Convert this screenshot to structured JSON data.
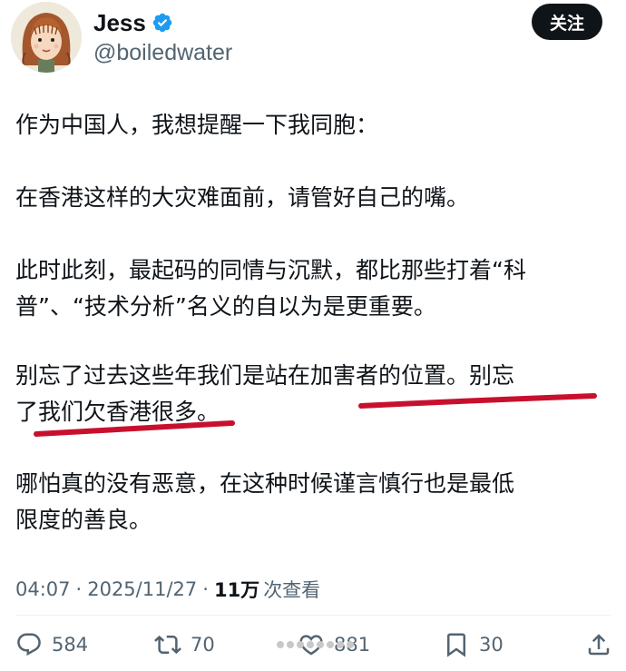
{
  "user": {
    "display_name": "Jess",
    "handle": "@boiledwater",
    "avatar_icon": "avatar-illustration",
    "verified_icon": "verified-badge-icon"
  },
  "follow_button": {
    "label": "关注"
  },
  "post": {
    "lines": [
      "作为中国人，我想提醒一下我同胞：",
      "在香港这样的大灾难面前，请管好自己的嘴。",
      "此时此刻，最起码的同情与沉默，都比那些打着“科",
      "普”、“技术分析”名义的自以为是更重要。",
      "别忘了过去这些年我们是站在加害者的位置。别忘",
      "了我们欠香港很多。",
      "哪怕真的没有恶意，在这种时候谨言慎行也是最低",
      "限度的善良。"
    ]
  },
  "meta": {
    "time": "04:07",
    "separator": "·",
    "date": "2025/11/27",
    "views_count": "11万",
    "views_label": "次查看"
  },
  "actions": {
    "reply_count": "584",
    "repost_count": "70",
    "like_count": "881",
    "bookmark_count": "30"
  },
  "colors": {
    "text": "#0f1419",
    "secondary": "#536471",
    "verified": "#1d9bf0",
    "annotation": "#c8102e"
  }
}
